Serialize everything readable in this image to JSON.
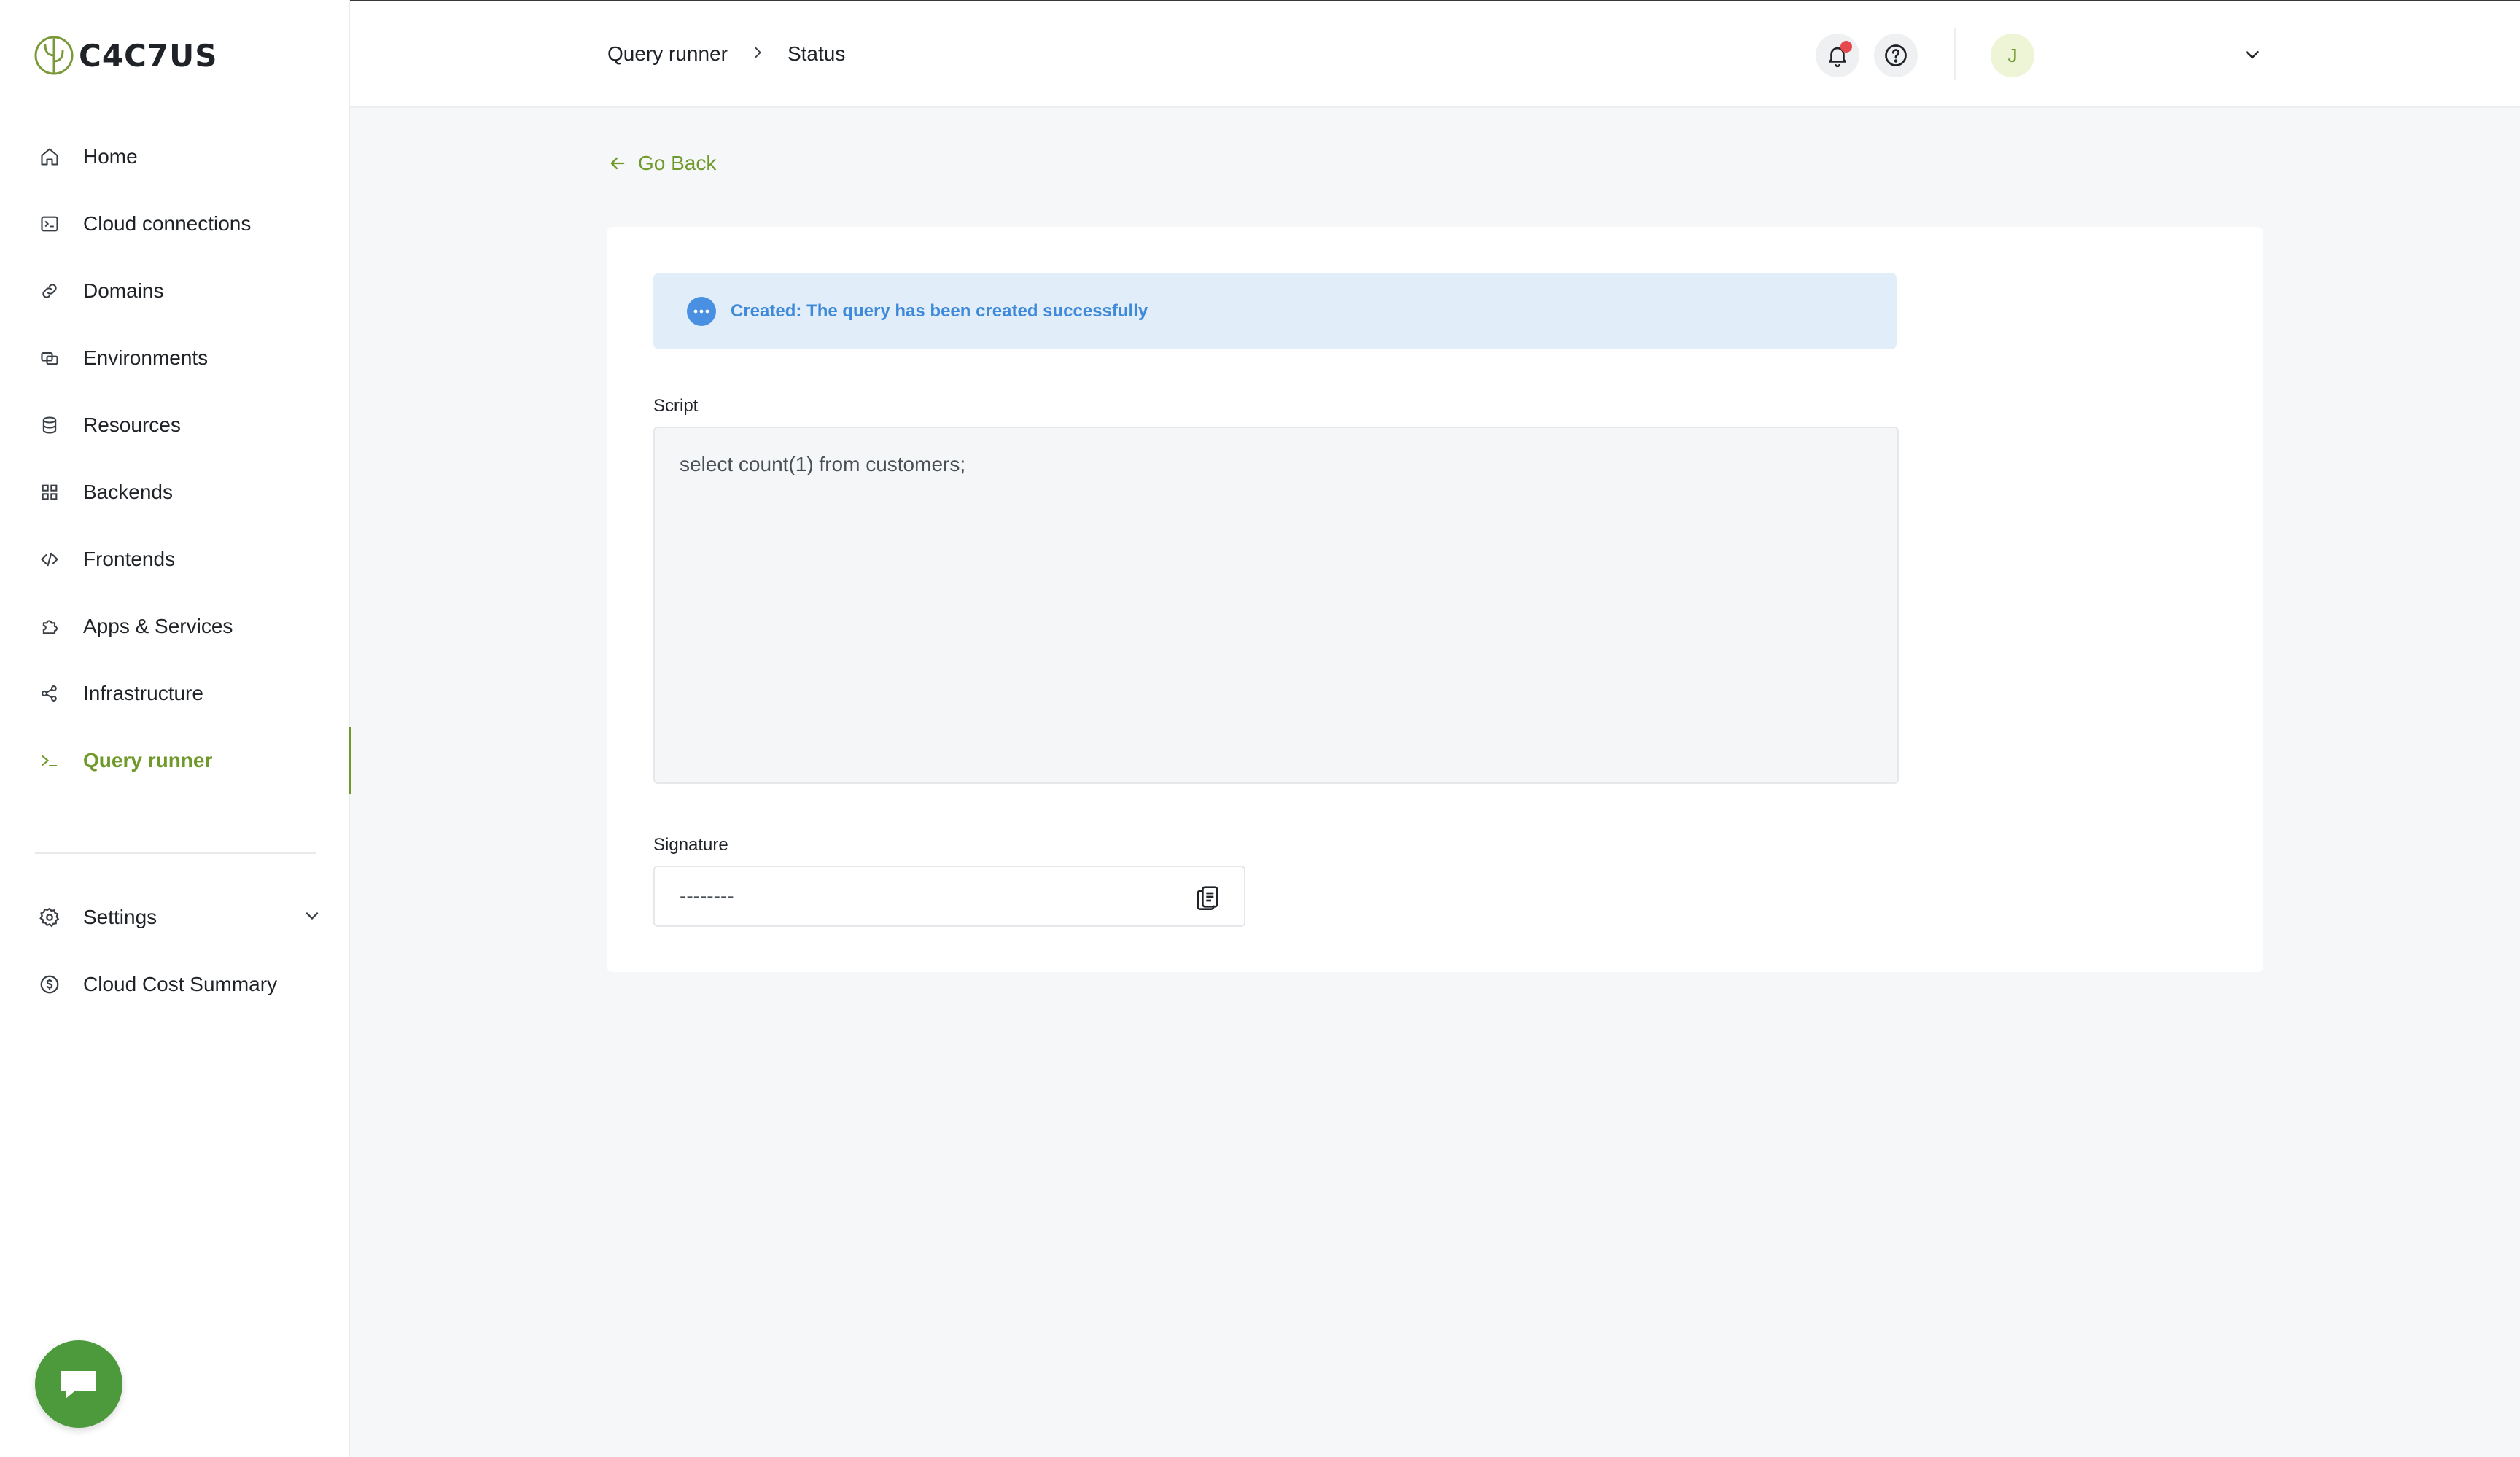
{
  "app": {
    "logo_text": "C4C7US"
  },
  "sidebar": {
    "items": [
      {
        "label": "Home",
        "icon": "home-icon"
      },
      {
        "label": "Cloud connections",
        "icon": "terminal-box-icon"
      },
      {
        "label": "Domains",
        "icon": "link-icon"
      },
      {
        "label": "Environments",
        "icon": "environments-icon"
      },
      {
        "label": "Resources",
        "icon": "database-icon"
      },
      {
        "label": "Backends",
        "icon": "grid-icon"
      },
      {
        "label": "Frontends",
        "icon": "code-icon"
      },
      {
        "label": "Apps & Services",
        "icon": "puzzle-icon"
      },
      {
        "label": "Infrastructure",
        "icon": "share-nodes-icon"
      },
      {
        "label": "Query runner",
        "icon": "terminal-prompt-icon",
        "active": true
      }
    ],
    "bottom_items": [
      {
        "label": "Settings",
        "icon": "gear-icon"
      },
      {
        "label": "Cloud Cost Summary",
        "icon": "dollar-circle-icon"
      }
    ]
  },
  "header": {
    "breadcrumb": [
      "Query runner",
      "Status"
    ],
    "avatar_initial": "J"
  },
  "main": {
    "go_back_label": "Go Back",
    "alert_text": "Created: The query has been created successfully",
    "script_label": "Script",
    "script_value": "select count(1) from customers;",
    "signature_label": "Signature",
    "signature_value": "--------"
  },
  "colors": {
    "accent": "#6f9a2b",
    "alert_bg": "#e1edf9",
    "alert_text": "#3f8ad8",
    "chat_button": "#4c9a3c",
    "notification_dot": "#e5484d"
  }
}
